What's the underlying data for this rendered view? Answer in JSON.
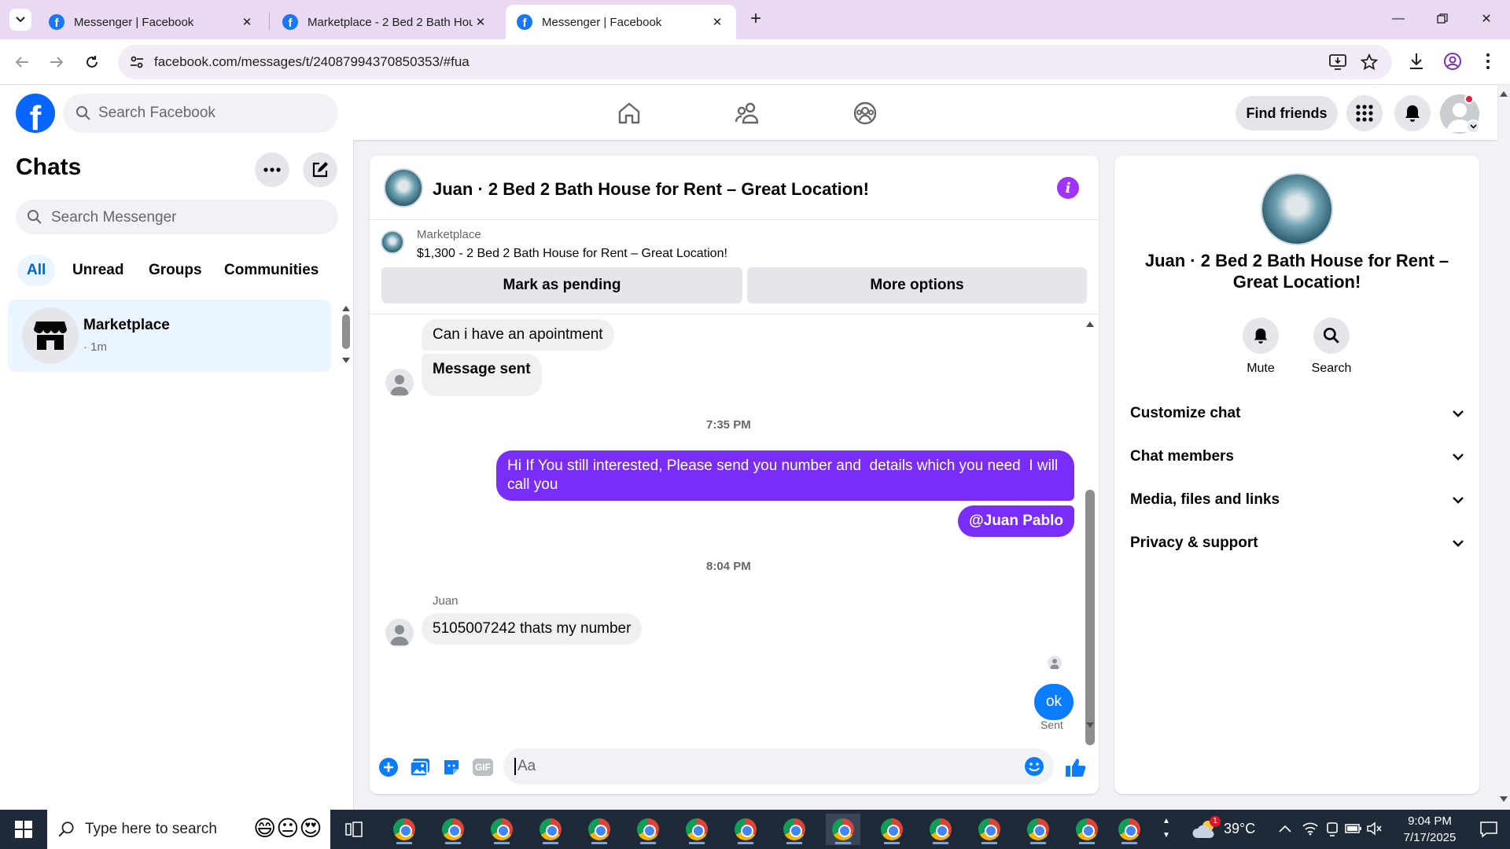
{
  "browser": {
    "tabs": [
      {
        "label": "Messenger | Facebook",
        "active": false
      },
      {
        "label": "Marketplace - 2 Bed 2 Bath Hou",
        "active": false
      },
      {
        "label": "Messenger | Facebook",
        "active": true
      }
    ],
    "url": "facebook.com/messages/t/24087994370850353/#fua"
  },
  "header": {
    "logo_letter": "f",
    "search_placeholder": "Search Facebook",
    "find_friends_label": "Find friends"
  },
  "sidebar": {
    "title": "Chats",
    "search_placeholder": "Search Messenger",
    "filters": [
      "All",
      "Unread",
      "Groups",
      "Communities"
    ],
    "active_filter": "All",
    "chats": [
      {
        "name": "Marketplace",
        "meta": "· 1m"
      }
    ]
  },
  "conversation": {
    "title": "Juan · 2 Bed 2 Bath House for Rent – Great Location!",
    "marketplace_label": "Marketplace",
    "listing": "$1,300 - 2 Bed 2 Bath House for Rent – Great Location!",
    "buttons": {
      "pending": "Mark as pending",
      "more": "More options"
    },
    "messages": {
      "m1": "Can i have an apointment",
      "m2": "Message sent",
      "ts1": "7:35 PM",
      "m3_line1": "Hi If You still interested, Please send you number and  details which you need  I will",
      "m3_line2": "call you",
      "m4": "@Juan Pablo",
      "ts2": "8:04 PM",
      "sender_name": "Juan",
      "m5": "5105007242 thats my number",
      "m6": "ok",
      "status": "Sent"
    },
    "composer_placeholder": "Aa",
    "gif_label": "GIF"
  },
  "info_panel": {
    "title": "Juan · 2 Bed 2 Bath House for Rent – Great Location!",
    "actions": [
      {
        "label": "Mute",
        "icon": "bell-icon"
      },
      {
        "label": "Search",
        "icon": "search-icon"
      }
    ],
    "sections": [
      "Customize chat",
      "Chat members",
      "Media, files and links",
      "Privacy & support"
    ]
  },
  "taskbar": {
    "search_placeholder": "Type here to search",
    "weather": "39°C",
    "weather_badge": "1",
    "time": "9:04 PM",
    "date": "7/17/2025"
  },
  "colors": {
    "brand": "#0866ff",
    "outgoing_bubble": "#7a2cf9",
    "sent_bubble": "#0a7cff",
    "info_icon": "#a033ff",
    "selected_bg": "#ebf5ff"
  }
}
